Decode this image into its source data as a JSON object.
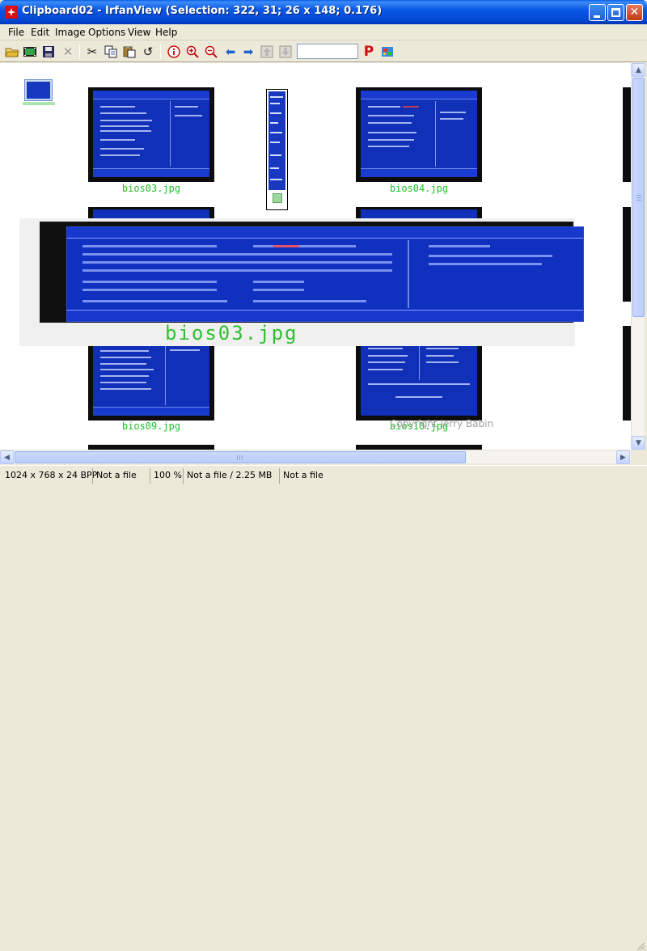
{
  "window": {
    "title": "Clipboard02 - IrfanView (Selection: 322, 31; 26 x 148; 0.176)",
    "accent": "#0a58e6"
  },
  "menu": {
    "items": [
      {
        "label": "File"
      },
      {
        "label": "Edit"
      },
      {
        "label": "Image"
      },
      {
        "label": "Options"
      },
      {
        "label": "View"
      },
      {
        "label": "Help"
      }
    ]
  },
  "toolbar": {
    "icons": [
      "open-folder-icon",
      "slideshow-icon",
      "save-icon",
      "delete-icon",
      "cut-icon",
      "copy-icon",
      "paste-icon",
      "undo-icon",
      "info-icon",
      "zoom-in-icon",
      "zoom-out-icon",
      "previous-icon",
      "next-icon",
      "move-up-icon",
      "move-down-icon",
      "print-icon",
      "paint-icon"
    ],
    "zoom_value": ""
  },
  "content": {
    "thumbnails": [
      {
        "caption": "bios03.jpg"
      },
      {
        "caption": "bios04.jpg"
      },
      {
        "caption": "bios09.jpg"
      },
      {
        "caption": "bios10.jpg"
      }
    ],
    "overlay_caption": "bios03.jpg",
    "watermark": "Copyright Jerry Babin"
  },
  "status": {
    "dimensions": "1024 x 768 x 24 BPP",
    "file1": "Not a file",
    "zoom": "100 %",
    "file_size": "Not a file / 2.25 MB",
    "file2": "Not a file"
  }
}
